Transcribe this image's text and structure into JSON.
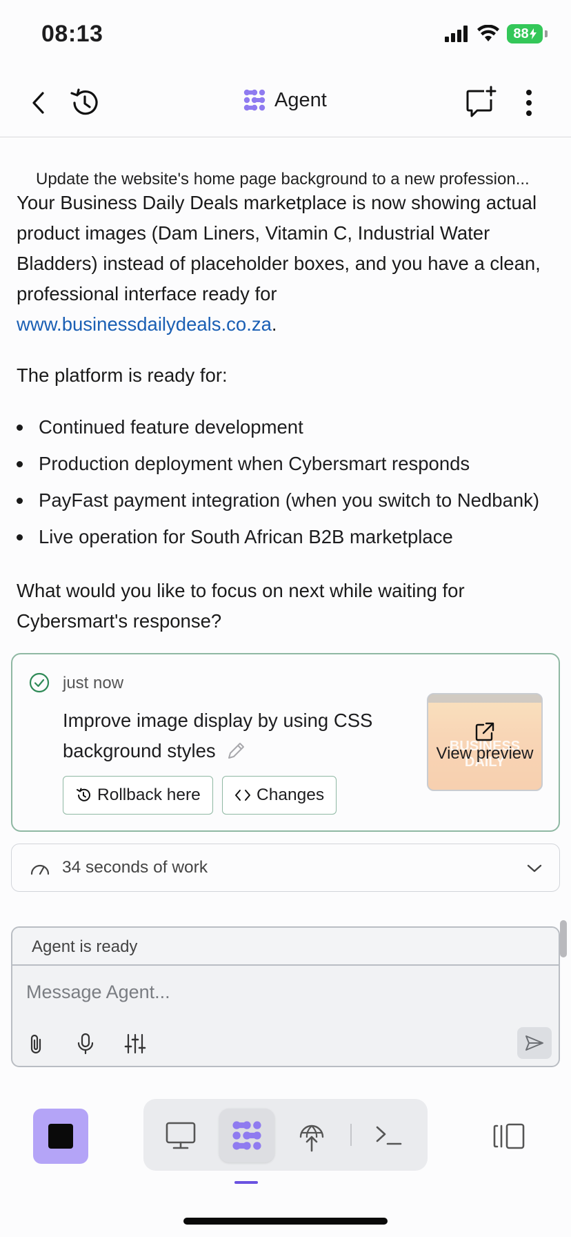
{
  "status_bar": {
    "time": "08:13",
    "battery": "88"
  },
  "header": {
    "title": "Agent",
    "icons": [
      "back-icon",
      "history-icon",
      "agent-logo-icon",
      "new-chat-icon",
      "more-icon"
    ]
  },
  "chat": {
    "prompt_truncated": "Update the website's home page background to a new profession...",
    "paragraph1_line1": "Your Business Daily Deals marketplace is now showing actual",
    "paragraph1_line2": "product images (Dam Liners, Vitamin C, Industrial Water",
    "paragraph1_line3": "Bladders) instead of placeholder boxes, and you have a clean,",
    "paragraph1_line4": "professional interface ready for",
    "paragraph1_link": "www.businessdailydeals.co.za",
    "paragraph1_end": ".",
    "paragraph2": "The platform is ready for:",
    "bullets": [
      "Continued feature development",
      "Production deployment when Cybersmart responds",
      "PayFast payment integration (when you switch to Nedbank)",
      "Live operation for South African B2B marketplace"
    ],
    "question_line1": "What would you like to focus on next while waiting for",
    "question_line2": "Cybersmart's response?"
  },
  "checkpoint": {
    "time": "just now",
    "title_line1": "Improve image display by using CSS",
    "title_line2": "background styles",
    "rollback_label": "Rollback here",
    "changes_label": "Changes",
    "preview_label": "View preview",
    "preview_thumbnail_text": "BUSINESS DAILY"
  },
  "work": {
    "label": "34 seconds of work"
  },
  "composer": {
    "status": "Agent is ready",
    "placeholder": "Message Agent..."
  },
  "colors": {
    "accent": "#b4a4f7",
    "link": "#1a5fb4",
    "checkpoint_border": "#8fb8a3",
    "battery": "#34c759",
    "active_underline": "#6a52e0"
  }
}
